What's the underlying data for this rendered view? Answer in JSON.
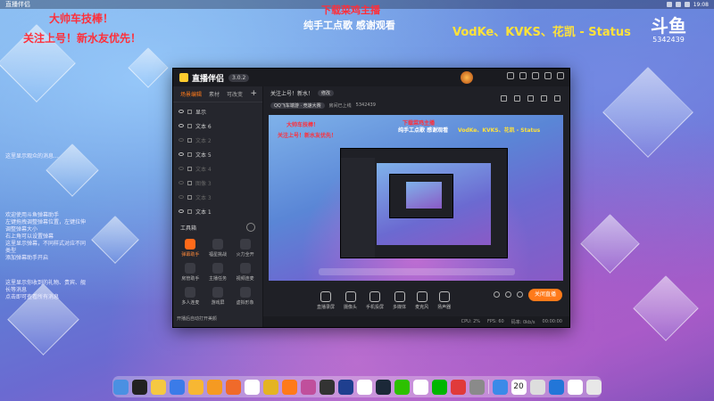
{
  "desktop": {
    "top_app": "直播伴侣",
    "clock": "19:08",
    "overlays": {
      "red1": "大帅车技棒！",
      "red2": "关注上号！新水友优先！",
      "red_center": "下载菜鸡主播",
      "white_center": "纯手工点歌 感谢观看",
      "yellow_right": "VodKe、KVKS、花凯 - Status"
    },
    "douyu_logo": "斗鱼",
    "douyu_number": "5342439",
    "side_notes": [
      "这里显示观众的消息...",
      "欢迎使用斗鱼弹幕助手",
      "左键拖拽调整弹幕位置，左键拉伸调整弹幕大小",
      "右上角可以设置弹幕",
      "这里显示弹幕，不同样式对应不同类型",
      "添加弹幕助手开启",
      "这里显示你收到的礼物、贵宾、舰长等消息",
      "点击即可查看所有消息"
    ]
  },
  "app": {
    "name": "直播伴侣",
    "version": "3.0.2",
    "tabs": [
      "场景编辑",
      "素材",
      "可改变"
    ],
    "scenes": [
      {
        "label": "显示",
        "dim": false
      },
      {
        "label": "文本 6",
        "dim": false
      },
      {
        "label": "文本 2",
        "dim": true
      },
      {
        "label": "文本 5",
        "dim": false
      },
      {
        "label": "文本 4",
        "dim": true
      },
      {
        "label": "图像 3",
        "dim": true
      },
      {
        "label": "文本 3",
        "dim": true
      },
      {
        "label": "文本 1",
        "dim": false
      }
    ],
    "tools_header": "工具箱",
    "tools": [
      {
        "label": "弹幕助手",
        "hot": true
      },
      {
        "label": "福星挑战",
        "hot": false
      },
      {
        "label": "火力全开",
        "hot": false
      },
      {
        "label": "房管助手",
        "hot": false
      },
      {
        "label": "主播任务",
        "hot": false
      },
      {
        "label": "视频连麦",
        "hot": false
      },
      {
        "label": "多人连麦",
        "hot": false
      },
      {
        "label": "游戏屏",
        "hot": false
      },
      {
        "label": "虚拟形象",
        "hot": false
      }
    ],
    "auto_note": "开播后自动打开美颜",
    "stream_title": "关注上号！新水！",
    "edit_label": "修改",
    "game_chip": "QQ飞车端游 · 竞速大赛",
    "room_label": "房间已上线",
    "room_id": "5342439",
    "controls": [
      "直播录屏",
      "摄像头",
      "手机投屏",
      "多媒体",
      "麦克风",
      "扬声器"
    ],
    "go_live": "关闭直播",
    "status": {
      "cpu": "CPU: 2%",
      "fps": "FPS: 60",
      "bitrate": "码率: 0kb/s",
      "time": "00:00:00"
    }
  },
  "preview": {
    "red1": "大帅车技棒！",
    "red2": "关注上号！新水友优先！",
    "red_center": "下载菜鸡主播",
    "white_center": "纯手工点歌 感谢观看",
    "yellow": "VodKe、KVKS、花凯 - Status"
  },
  "dock": {
    "icons": [
      {
        "name": "files-icon",
        "color": "#4a90e2"
      },
      {
        "name": "terminal-icon",
        "color": "#222"
      },
      {
        "name": "avatar-app-icon",
        "color": "#f5c842"
      },
      {
        "name": "k-app-icon",
        "color": "#3b7be8"
      },
      {
        "name": "coin-app-icon",
        "color": "#f7b733"
      },
      {
        "name": "g-app-icon",
        "color": "#f59a22"
      },
      {
        "name": "orange-app-icon",
        "color": "#f06a2a"
      },
      {
        "name": "chat-app-icon",
        "color": "#fff"
      },
      {
        "name": "music-app-icon",
        "color": "#e4b422"
      },
      {
        "name": "live-app-icon",
        "color": "#ff7a1a"
      },
      {
        "name": "gem-app-icon",
        "color": "#c04f9c"
      },
      {
        "name": "dark-app-icon",
        "color": "#333"
      },
      {
        "name": "moon-app-icon",
        "color": "#1f3f8f"
      },
      {
        "name": "search-app-icon",
        "color": "#fff"
      },
      {
        "name": "steam-icon",
        "color": "#1b2838"
      },
      {
        "name": "wechat-icon",
        "color": "#2dc100"
      },
      {
        "name": "qq-icon",
        "color": "#fff"
      },
      {
        "name": "iqiyi-icon",
        "color": "#00b600"
      },
      {
        "name": "game-app-icon",
        "color": "#e03a3a"
      },
      {
        "name": "settings-icon",
        "color": "#8a8a8a"
      },
      {
        "name": "send-app-icon",
        "color": "#3b8ae8"
      },
      {
        "name": "calendar-icon",
        "color": "#fff"
      },
      {
        "name": "camera-app-icon",
        "color": "#ddd"
      },
      {
        "name": "azure-app-icon",
        "color": "#2276d8"
      },
      {
        "name": "mail-app-icon",
        "color": "#fff"
      },
      {
        "name": "trash-icon",
        "color": "#e8e8e8"
      }
    ],
    "calendar_day": "20"
  }
}
